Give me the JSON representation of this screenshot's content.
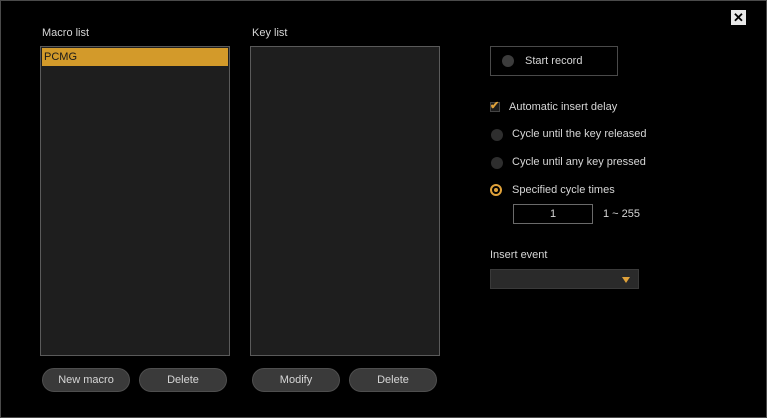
{
  "window": {
    "close_icon": "close-icon"
  },
  "macro_list": {
    "label": "Macro list",
    "items": [
      "PCMG"
    ],
    "new_button": "New macro",
    "delete_button": "Delete"
  },
  "key_list": {
    "label": "Key list",
    "modify_button": "Modify",
    "delete_button": "Delete"
  },
  "record": {
    "label": "Start record"
  },
  "options": {
    "auto_delay": {
      "label": "Automatic insert delay",
      "checked": true
    },
    "cycle_released": {
      "label": "Cycle until the key released",
      "selected": false
    },
    "cycle_any_key": {
      "label": "Cycle until any key pressed",
      "selected": false
    },
    "specified_cycles": {
      "label": "Specified cycle times",
      "selected": true
    },
    "cycle_value": "1",
    "cycle_range": "1 ~ 255"
  },
  "insert_event": {
    "label": "Insert event",
    "value": ""
  },
  "colors": {
    "accent": "#e0a23a",
    "selection": "#d39a2a",
    "panel": "#1e1e1e"
  }
}
